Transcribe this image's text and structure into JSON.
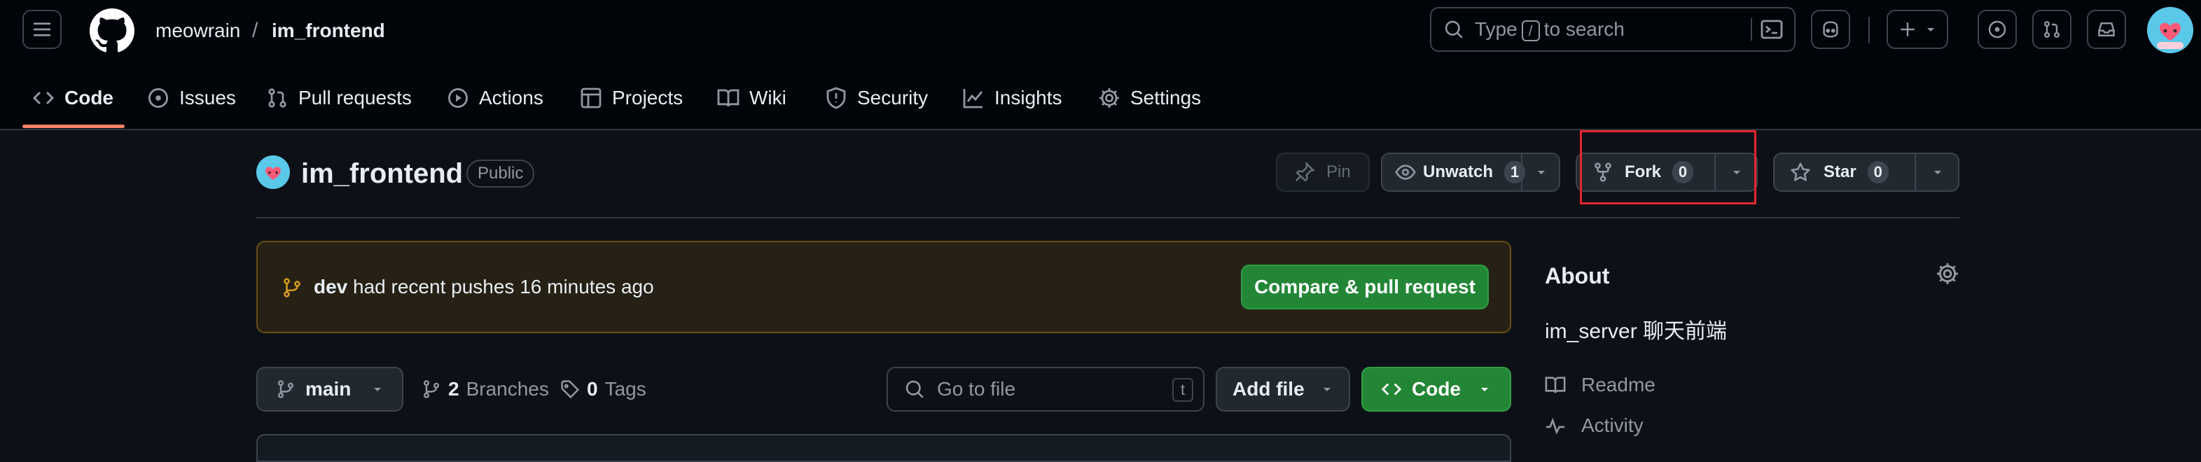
{
  "header": {
    "owner": "meowrain",
    "separator": "/",
    "repo": "im_frontend",
    "search": {
      "prefix": "Type",
      "key": "/",
      "suffix": "to search"
    }
  },
  "nav": {
    "items": [
      {
        "label": "Code",
        "icon": "code-icon"
      },
      {
        "label": "Issues",
        "icon": "issue-icon"
      },
      {
        "label": "Pull requests",
        "icon": "pull-request-icon"
      },
      {
        "label": "Actions",
        "icon": "play-icon"
      },
      {
        "label": "Projects",
        "icon": "table-icon"
      },
      {
        "label": "Wiki",
        "icon": "book-icon"
      },
      {
        "label": "Security",
        "icon": "shield-icon"
      },
      {
        "label": "Insights",
        "icon": "graph-icon"
      },
      {
        "label": "Settings",
        "icon": "gear-icon"
      }
    ],
    "active": "Code"
  },
  "repo": {
    "name": "im_frontend",
    "visibility": "Public",
    "pin_label": "Pin",
    "unwatch_label": "Unwatch",
    "watch_count": "1",
    "fork_label": "Fork",
    "fork_count": "0",
    "star_label": "Star",
    "star_count": "0"
  },
  "banner": {
    "branch": "dev",
    "message": "had recent pushes 16 minutes ago",
    "button": "Compare & pull request"
  },
  "toolbar": {
    "branch": "main",
    "branches_count": "2",
    "branches_label": "Branches",
    "tags_count": "0",
    "tags_label": "Tags",
    "goto_placeholder": "Go to file",
    "goto_key": "t",
    "add_file": "Add file",
    "code": "Code"
  },
  "about": {
    "title": "About",
    "description": "im_server 聊天前端",
    "links": [
      {
        "label": "Readme",
        "icon": "book-icon"
      },
      {
        "label": "Activity",
        "icon": "pulse-icon"
      }
    ]
  },
  "colors": {
    "background": "#0d1117",
    "header": "#010409",
    "accent_underline": "#f78166",
    "primary_button": "#238636",
    "banner_bg": "#272115",
    "highlight": "#e5262b"
  }
}
